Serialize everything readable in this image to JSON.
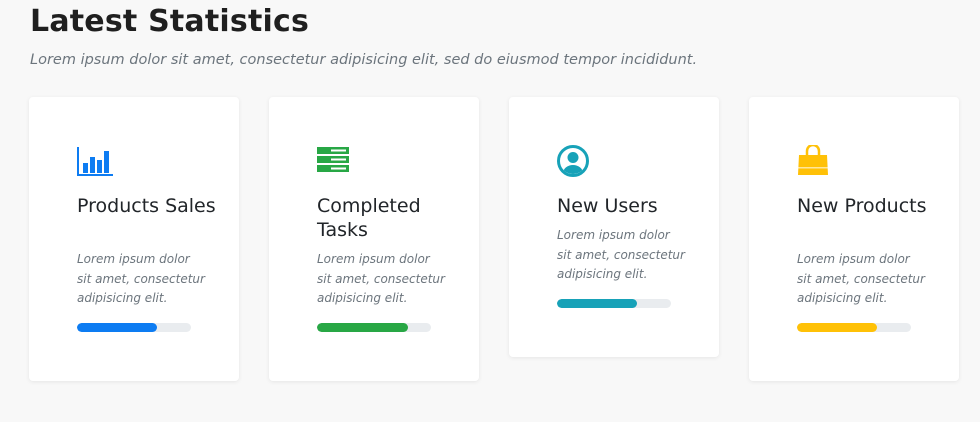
{
  "header": {
    "title": "Latest Statistics",
    "subtitle": "Lorem ipsum dolor sit amet, consectetur adipisicing elit, sed do eiusmod tempor incididunt."
  },
  "cards": [
    {
      "icon": "bar-chart-icon",
      "title": "Products Sales",
      "description": "Lorem ipsum dolor sit amet, consectetur adipisicing elit.",
      "progress_percent": 70,
      "color": "#0d7cf2"
    },
    {
      "icon": "server-icon",
      "title": "Completed Tasks",
      "description": "Lorem ipsum dolor sit amet, consectetur adipisicing elit.",
      "progress_percent": 80,
      "color": "#28a745"
    },
    {
      "icon": "user-circle-icon",
      "title": "New Users",
      "description": "Lorem ipsum dolor sit amet, consectetur adipisicing elit.",
      "progress_percent": 70,
      "color": "#17a2b8"
    },
    {
      "icon": "shopping-bag-icon",
      "title": "New Products",
      "description": "Lorem ipsum dolor sit amet, consectetur adipisicing elit.",
      "progress_percent": 70,
      "color": "#ffc107"
    }
  ]
}
